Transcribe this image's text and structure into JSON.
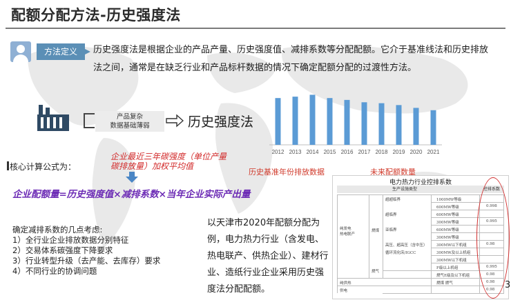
{
  "header": {
    "title": "配额分配方法-历史强度法"
  },
  "definition": {
    "label": "方法定义",
    "text": "历史强度法是根据企业的产品产量、历史强度值、减排系数等分配配额。它介于基准线法和历史排放法之间，通常是在缺乏行业和产品标杆数据的情况下确定配额分配的过渡性方法。"
  },
  "flow": {
    "box_line1": "产品复杂",
    "box_line2": "数据基础薄弱",
    "result": "历史强度法"
  },
  "chart_data": {
    "type": "bar",
    "categories": [
      "2012",
      "2013",
      "2014",
      "2015",
      "2016",
      "2017",
      "2018",
      "2019",
      "2020",
      "2021"
    ],
    "values": [
      100,
      103,
      107,
      100,
      96,
      91,
      89,
      85,
      79,
      74
    ],
    "ylim": [
      0,
      115
    ],
    "legend_base": "历史基准年份排放数据",
    "legend_future": "未来配额数量",
    "color": "#5b9bd5"
  },
  "core": {
    "label": "核心计算公式为：",
    "note": "企业最近三年碳强度（单位产量碳排放量）加权平均值",
    "formula": "企业配额量=历史强度值×减排系数×当年企业实际产出量"
  },
  "factors": {
    "title": "确定减排系数的几点考虑:",
    "items": [
      "1）全行业企业排放数据分别特征",
      "2）交易体系碳强度下降要求",
      "3）行业转型升级（去产能、去库存）要求",
      "4）不同行业的协调问题"
    ]
  },
  "example": {
    "text": "以天津市2020年配额分配为例，电力热力行业（含发电、热电联产、供热企业）、建材行业、造纸行业企业采用历史强度法分配配额。"
  },
  "table": {
    "title": "电力热力行业控排系数",
    "col_type": "生产设施类型",
    "col_factor": "控排系数",
    "group": "纯发电\n热电联产",
    "fuel_coal": "燃煤",
    "fuel_gas": "燃气",
    "rows": [
      {
        "type": "超超临界",
        "cap": "1000MW等级",
        "factor": ""
      },
      {
        "type": "",
        "cap": "600MW等级",
        "factor": "0.998"
      },
      {
        "type": "超临界",
        "cap": "600MW等级",
        "factor": ""
      },
      {
        "type": "",
        "cap": "300MW等级",
        "factor": "0.995"
      },
      {
        "type": "亚临界",
        "cap": "600MW等级",
        "factor": ""
      },
      {
        "type": "",
        "cap": "300MW等级",
        "factor": ""
      },
      {
        "type": "高压、超高压（含中压）",
        "cap": "300MW以下机组",
        "factor": "0.98"
      },
      {
        "type": "循环流化床/IGCC",
        "cap": "300MW及以上机组",
        "factor": ""
      },
      {
        "type": "",
        "cap": "300MW以下机组",
        "factor": ""
      },
      {
        "type": "",
        "cap": "F级以上机组",
        "factor": "0.995"
      },
      {
        "type": "",
        "cap": "燃气E级及以下机组",
        "factor": "0.98"
      },
      {
        "type": "纯供热",
        "cap": "燃煤 燃气",
        "factor": "0.98"
      },
      {
        "type": "供电",
        "cap": "",
        "factor": "0.98"
      }
    ]
  },
  "page": {
    "number": "3"
  }
}
